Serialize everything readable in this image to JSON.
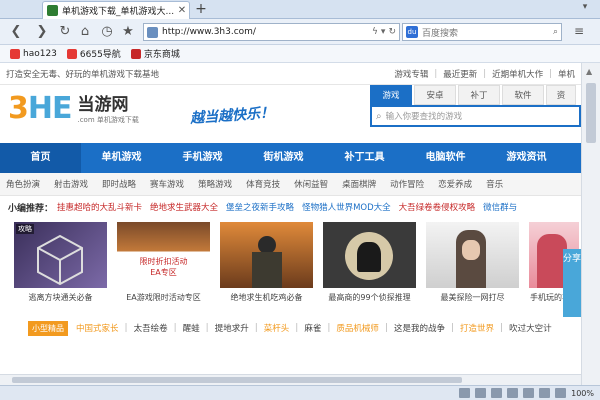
{
  "browser": {
    "tab_title": "单机游戏下载_单机游戏大...",
    "new_tab": "+",
    "address": "http://www.3h3.com/",
    "search_placeholder": "百度搜索",
    "favorites": [
      {
        "label": "hao123",
        "color": "#e53935"
      },
      {
        "label": "6655导航",
        "color": "#e53935"
      },
      {
        "label": "京东商城",
        "color": "#c62828"
      }
    ],
    "zoom": "100%"
  },
  "page": {
    "topstrip_text": "打造安全无毒、好玩的单机游戏下载基地",
    "topstrip_links": [
      "游戏专辑",
      "最近更新",
      "近期单机大作",
      "单机"
    ],
    "logo_main": "3HE",
    "logo_cn": "当游网",
    "logo_sub": ".com 单机游戏下载",
    "slogan": "越当越快乐！",
    "search_tabs": [
      "游戏",
      "安卓",
      "补丁",
      "软件",
      "资"
    ],
    "search_placeholder": "输入你要查找的游戏",
    "main_nav": [
      "首页",
      "单机游戏",
      "手机游戏",
      "街机游戏",
      "补丁工具",
      "电脑软件",
      "游戏资讯"
    ],
    "sub_nav": [
      "角色扮演",
      "射击游戏",
      "即时战略",
      "赛车游戏",
      "策略游戏",
      "体育竞技",
      "休闲益智",
      "桌面棋牌",
      "动作冒险",
      "恋爱养成",
      "音乐"
    ],
    "recommend_label": "小编推荐：",
    "recommend_items": [
      {
        "text": "挂惠超哈的大乱斗新卡",
        "color": "#c62828"
      },
      {
        "text": "绝地求生武器大全",
        "color": "#c62828"
      },
      {
        "text": "堡垒之夜新手攻略",
        "color": "#1b6fc6"
      },
      {
        "text": "怪物猎人世界MOD大全",
        "color": "#1b6fc6"
      },
      {
        "text": "大吾绿卷卷侵权攻略",
        "color": "#c62828"
      },
      {
        "text": "微信群与",
        "color": "#1b6fc6"
      }
    ],
    "cards": [
      {
        "caption": "逃离方块通关必备",
        "badge": "攻略"
      },
      {
        "caption": "EA游戏限时活动专区",
        "badge": "限时折扣活动\nEA专区"
      },
      {
        "caption": "绝地求生机吃鸡必备",
        "badge": ""
      },
      {
        "caption": "最高商的99个侦探推理",
        "badge": ""
      },
      {
        "caption": "最美探险一网打尽",
        "badge": ""
      },
      {
        "caption": "手机玩的事件",
        "badge": ""
      }
    ],
    "share_label": "分享",
    "bottom_badge": "小型精品",
    "bottom_items": [
      {
        "text": "中国式家长",
        "color": "#f29a1f"
      },
      {
        "text": "太吾绘卷",
        "color": "#444"
      },
      {
        "text": "醒蛙",
        "color": "#444"
      },
      {
        "text": "提地求升",
        "color": "#444"
      },
      {
        "text": "菜杆头",
        "color": "#f29a1f"
      },
      {
        "text": "麻雀",
        "color": "#444"
      },
      {
        "text": "质品机械师",
        "color": "#f29a1f"
      },
      {
        "text": "这是我的战争",
        "color": "#444"
      },
      {
        "text": "打造世界",
        "color": "#f29a1f"
      },
      {
        "text": "吹过大空计",
        "color": "#444"
      }
    ]
  }
}
